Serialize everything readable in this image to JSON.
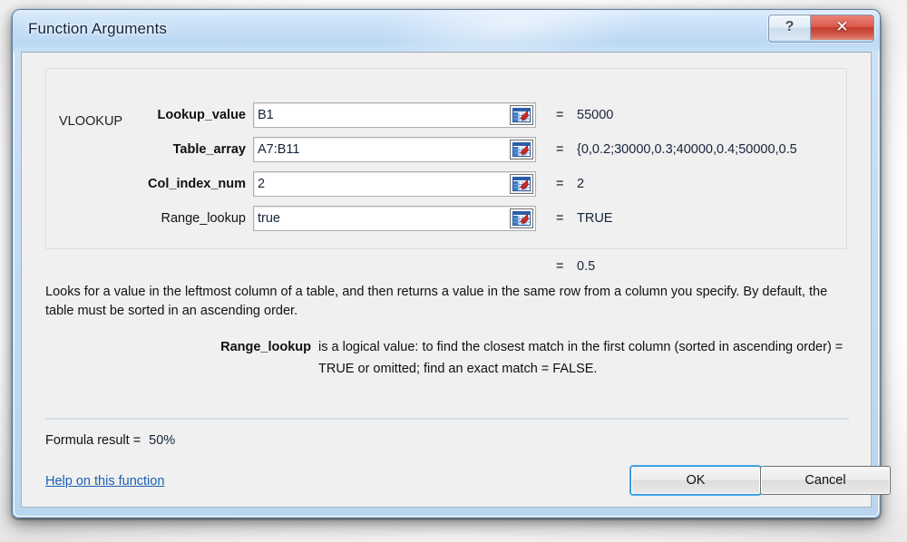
{
  "window": {
    "title": "Function Arguments",
    "help_button_glyph": "?",
    "close_button_glyph": "✕"
  },
  "groupbox": {
    "label": "VLOOKUP"
  },
  "arguments": [
    {
      "label": "Lookup_value",
      "bold": true,
      "value": "B1",
      "equals": "=",
      "result": "55000",
      "range_icon": "range-selector-icon"
    },
    {
      "label": "Table_array",
      "bold": true,
      "value": "A7:B11",
      "equals": "=",
      "result": "{0,0.2;30000,0.3;40000,0.4;50000,0.5",
      "range_icon": "range-selector-icon"
    },
    {
      "label": "Col_index_num",
      "bold": true,
      "value": "2",
      "equals": "=",
      "result": "2",
      "range_icon": "range-selector-icon"
    },
    {
      "label": "Range_lookup",
      "bold": false,
      "value": "true",
      "equals": "=",
      "result": "TRUE",
      "range_icon": "range-selector-icon"
    }
  ],
  "overall_result": {
    "equals": "=",
    "value": "0.5"
  },
  "description": "Looks for a value in the leftmost column of a table, and then returns a value in the same row from a column you specify. By default, the table must be sorted in an ascending order.",
  "argument_help": {
    "name": "Range_lookup",
    "text": "is a logical value: to find the closest match in the first column (sorted in ascending order) = TRUE or omitted; find an exact match = FALSE."
  },
  "footer": {
    "formula_result_label": "Formula result =",
    "formula_result_value": "50%",
    "help_link": "Help on this function",
    "ok_label": "OK",
    "cancel_label": "Cancel"
  },
  "colors": {
    "titlebar_blue": "#c4ddf6",
    "close_red": "#c23c2c",
    "link_blue": "#1a5fb4",
    "focus_blue": "#49aef0",
    "client_bg": "#f0f0f0",
    "icon_grid_blue": "#2a5fa8",
    "icon_arrow_red": "#cc2a20"
  }
}
